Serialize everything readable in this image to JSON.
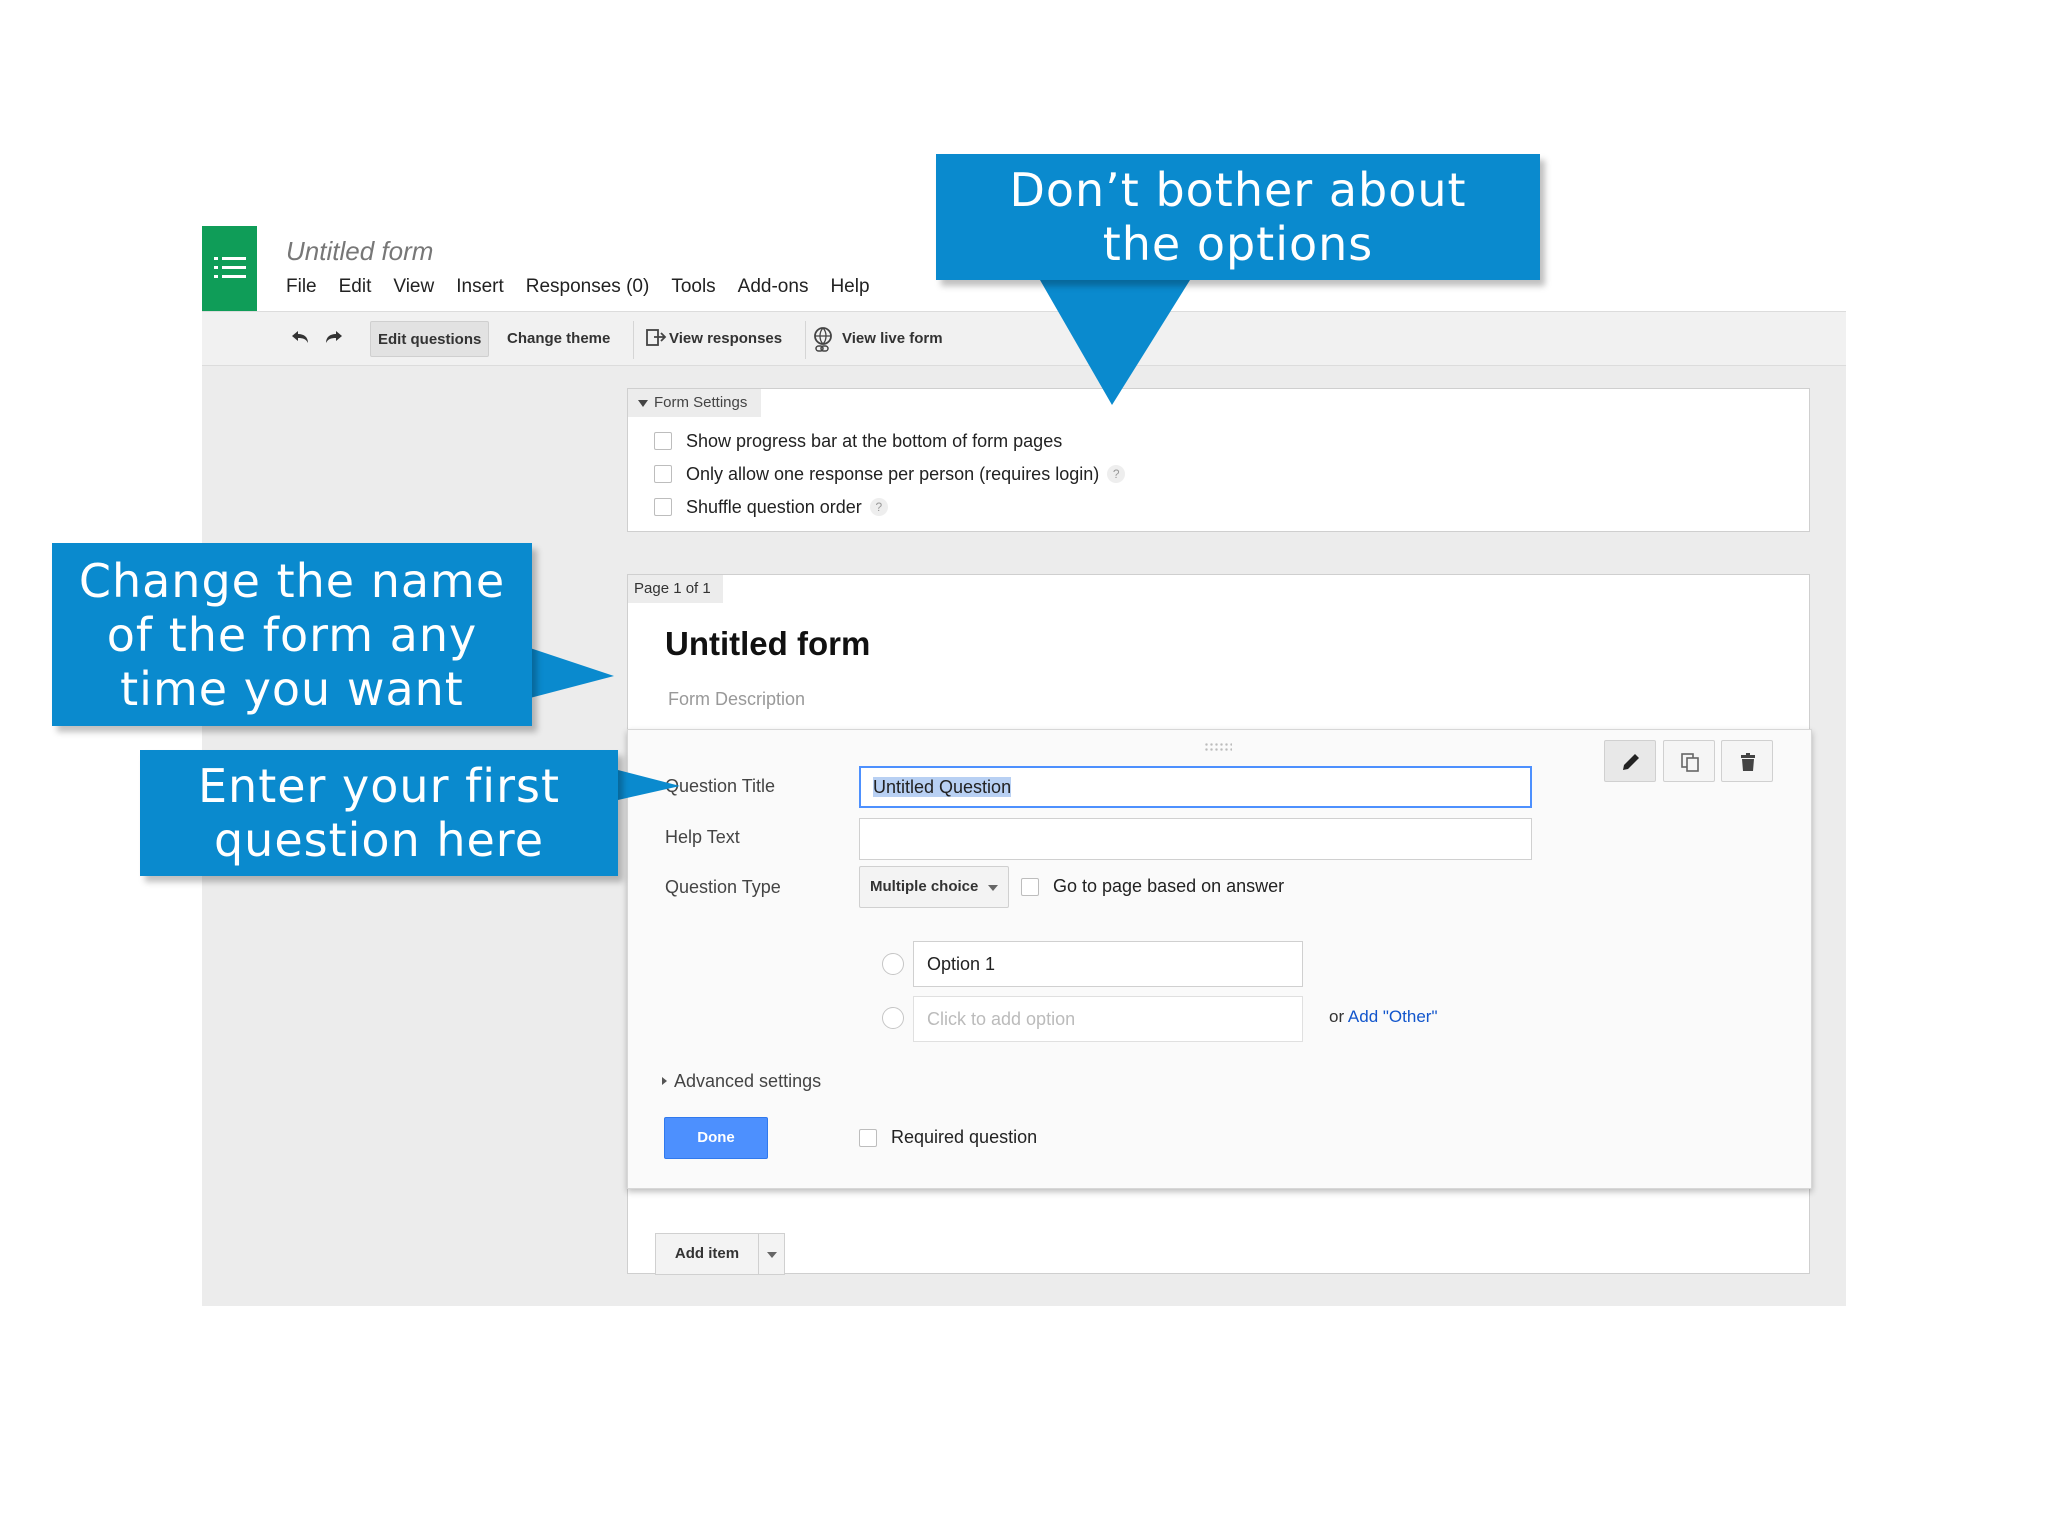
{
  "app": {
    "doc_title": "Untitled form",
    "menu": [
      "File",
      "Edit",
      "View",
      "Insert",
      "Responses (0)",
      "Tools",
      "Add-ons",
      "Help"
    ],
    "brand_color": "#0f9d58"
  },
  "toolbar": {
    "edit_questions": "Edit questions",
    "change_theme": "Change theme",
    "view_responses": "View responses",
    "view_live_form": "View live form"
  },
  "settings": {
    "tab_label": "Form Settings",
    "options": [
      "Show progress bar at the bottom of form pages",
      "Only allow one response per person (requires login)",
      "Shuffle question order"
    ],
    "help_glyph": "?"
  },
  "page": {
    "tab_label": "Page 1 of 1",
    "form_title": "Untitled form",
    "form_description": "Form Description"
  },
  "question": {
    "title_label": "Question Title",
    "title_value": "Untitled Question",
    "help_label": "Help Text",
    "help_value": "",
    "type_label": "Question Type",
    "type_value": "Multiple choice",
    "goto_label": "Go to page based on answer",
    "option_1": "Option 1",
    "add_option_placeholder": "Click to add option",
    "or_text": "or",
    "add_other": "Add \"Other\"",
    "advanced": "Advanced settings",
    "done": "Done",
    "required": "Required question"
  },
  "add_item": "Add item",
  "callouts": {
    "options": "Don’t bother about\nthe options",
    "name": "Change the name\nof the form any\ntime you want",
    "first_question": "Enter your first\nquestion here",
    "color": "#0a8ace"
  }
}
